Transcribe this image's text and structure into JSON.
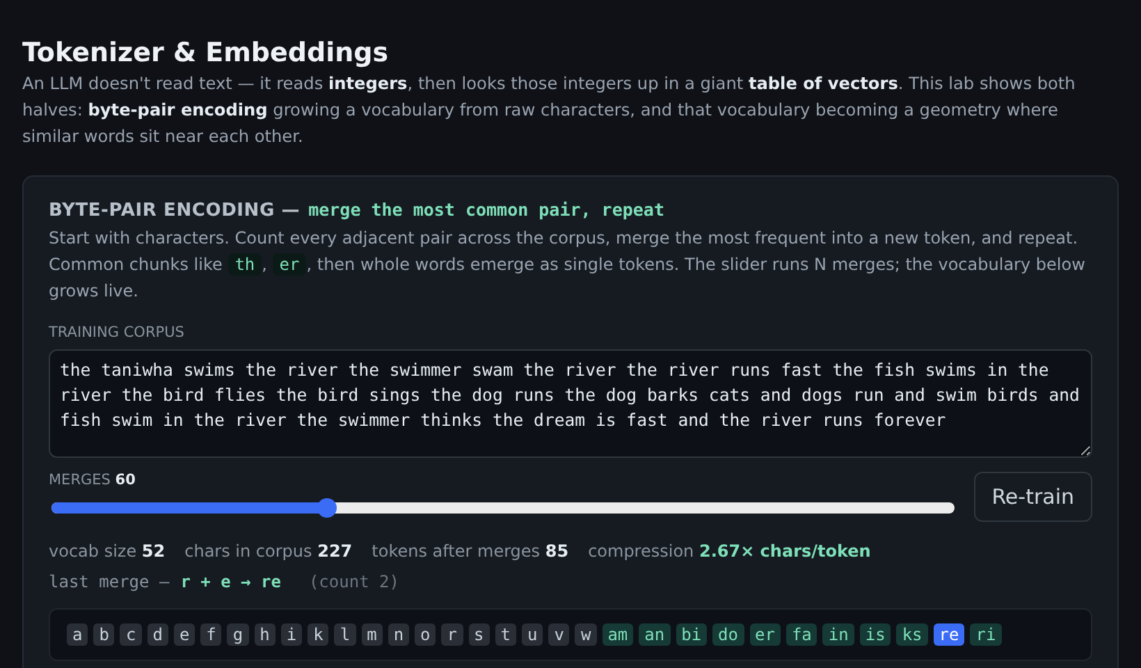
{
  "header": {
    "title": "Tokenizer & Embeddings",
    "description": "An LLM doesn't read text — it reads **integers**, then looks those integers up in a giant **table of vectors**. This lab shows both halves: **byte-pair encoding** growing a vocabulary from raw characters, and that vocabulary becoming a geometry where similar words sit near each other."
  },
  "bpe": {
    "title": "BYTE-PAIR ENCODING —",
    "subtitle": "merge the most common pair, repeat",
    "intro": [
      {
        "kind": "text",
        "text": "Start with characters. Count every adjacent pair across the corpus, merge the most frequent into a new token, and repeat. Common chunks like "
      },
      {
        "kind": "code",
        "text": "th"
      },
      {
        "kind": "text",
        "text": ", "
      },
      {
        "kind": "code",
        "text": "er"
      },
      {
        "kind": "text",
        "text": ", then whole words emerge as single tokens. The slider runs N merges; the vocabulary below grows live."
      }
    ],
    "corpus_label": "TRAINING CORPUS",
    "corpus": "the taniwha swims the river the swimmer swam the river the river runs fast the fish swims in the river the bird flies the bird sings the dog runs the dog barks cats and dogs run and swim birds and fish swim in the river the swimmer thinks the dream is fast and the river runs forever",
    "merges": {
      "label": "MERGES",
      "value": "60",
      "level": 0.305
    },
    "retrain_button": "Re-train",
    "stats": [
      {
        "label": "vocab size",
        "value": "52",
        "kind": "plain"
      },
      {
        "label": "chars in corpus",
        "value": "227",
        "kind": "plain"
      },
      {
        "label": "tokens after merges",
        "value": "85",
        "kind": "plain"
      },
      {
        "label": "compression",
        "value": "2.67× chars/token",
        "kind": "accent"
      }
    ],
    "last_merge": {
      "label": "last merge —",
      "pair": "r + e → re",
      "count": "(count 2)"
    },
    "tokens": [
      {
        "text": "a",
        "kind": "char"
      },
      {
        "text": "b",
        "kind": "char"
      },
      {
        "text": "c",
        "kind": "char"
      },
      {
        "text": "d",
        "kind": "char"
      },
      {
        "text": "e",
        "kind": "char"
      },
      {
        "text": "f",
        "kind": "char"
      },
      {
        "text": "g",
        "kind": "char"
      },
      {
        "text": "h",
        "kind": "char"
      },
      {
        "text": "i",
        "kind": "char"
      },
      {
        "text": "k",
        "kind": "char"
      },
      {
        "text": "l",
        "kind": "char"
      },
      {
        "text": "m",
        "kind": "char"
      },
      {
        "text": "n",
        "kind": "char"
      },
      {
        "text": "o",
        "kind": "char"
      },
      {
        "text": "r",
        "kind": "char"
      },
      {
        "text": "s",
        "kind": "char"
      },
      {
        "text": "t",
        "kind": "char"
      },
      {
        "text": "u",
        "kind": "char"
      },
      {
        "text": "v",
        "kind": "char"
      },
      {
        "text": "w",
        "kind": "char"
      },
      {
        "text": "am",
        "kind": "merged"
      },
      {
        "text": "an",
        "kind": "merged"
      },
      {
        "text": "bi",
        "kind": "merged"
      },
      {
        "text": "do",
        "kind": "merged"
      },
      {
        "text": "er",
        "kind": "merged"
      },
      {
        "text": "fa",
        "kind": "merged"
      },
      {
        "text": "in",
        "kind": "merged"
      },
      {
        "text": "is",
        "kind": "merged"
      },
      {
        "text": "ks",
        "kind": "merged"
      },
      {
        "text": "re",
        "kind": "latest"
      },
      {
        "text": "ri",
        "kind": "merged"
      }
    ]
  }
}
